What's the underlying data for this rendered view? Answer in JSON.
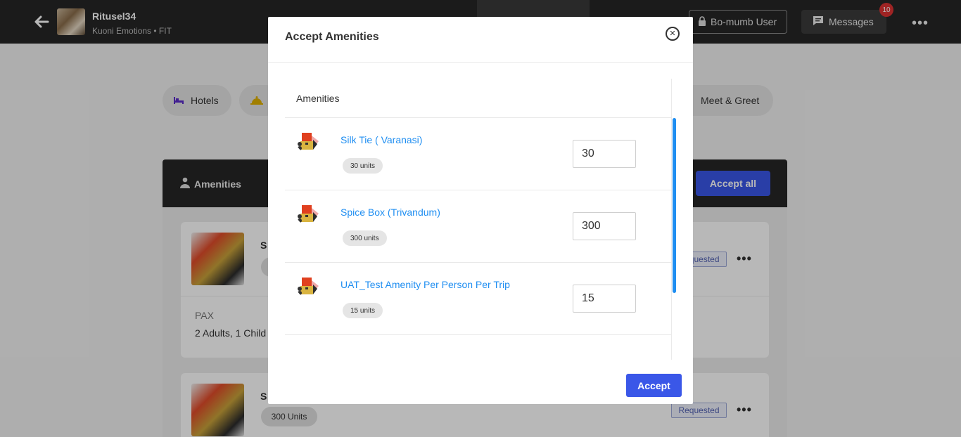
{
  "header": {
    "trip_title": "Ritusel34",
    "trip_subtitle": "Kuoni Emotions • FIT",
    "user_label": "Bo-mumb User",
    "messages_label": "Messages",
    "messages_count": "10"
  },
  "tabs": {
    "hotels": "Hotels",
    "meet_greet": "Meet & Greet"
  },
  "panel": {
    "title": "Amenities",
    "accept_all": "Accept all",
    "cards": [
      {
        "initial": "S",
        "status": "Requested",
        "pax_label": "PAX",
        "pax_value": "2 Adults, 1 Child"
      },
      {
        "initial": "S",
        "chip": "300 Units",
        "status": "Requested"
      }
    ]
  },
  "modal": {
    "title": "Accept Amenities",
    "list_header": "Amenities",
    "accept_label": "Accept",
    "items": [
      {
        "name": "Silk Tie ( Varanasi)",
        "units": "30 units",
        "quantity": "30"
      },
      {
        "name": "Spice Box (Trivandum)",
        "units": "300 units",
        "quantity": "300"
      },
      {
        "name": "UAT_Test Amenity Per Person Per Trip",
        "units": "15 units",
        "quantity": "15"
      }
    ]
  },
  "colors": {
    "accent": "#3a57e8",
    "link": "#1f8ef1",
    "topbar": "#262626",
    "badge": "#d33333"
  },
  "icons": [
    "back-arrow-icon",
    "lock-icon",
    "chat-icon",
    "more-icon",
    "bed-icon",
    "bell-icon",
    "person-icon",
    "close-icon",
    "gift-box-icon"
  ]
}
